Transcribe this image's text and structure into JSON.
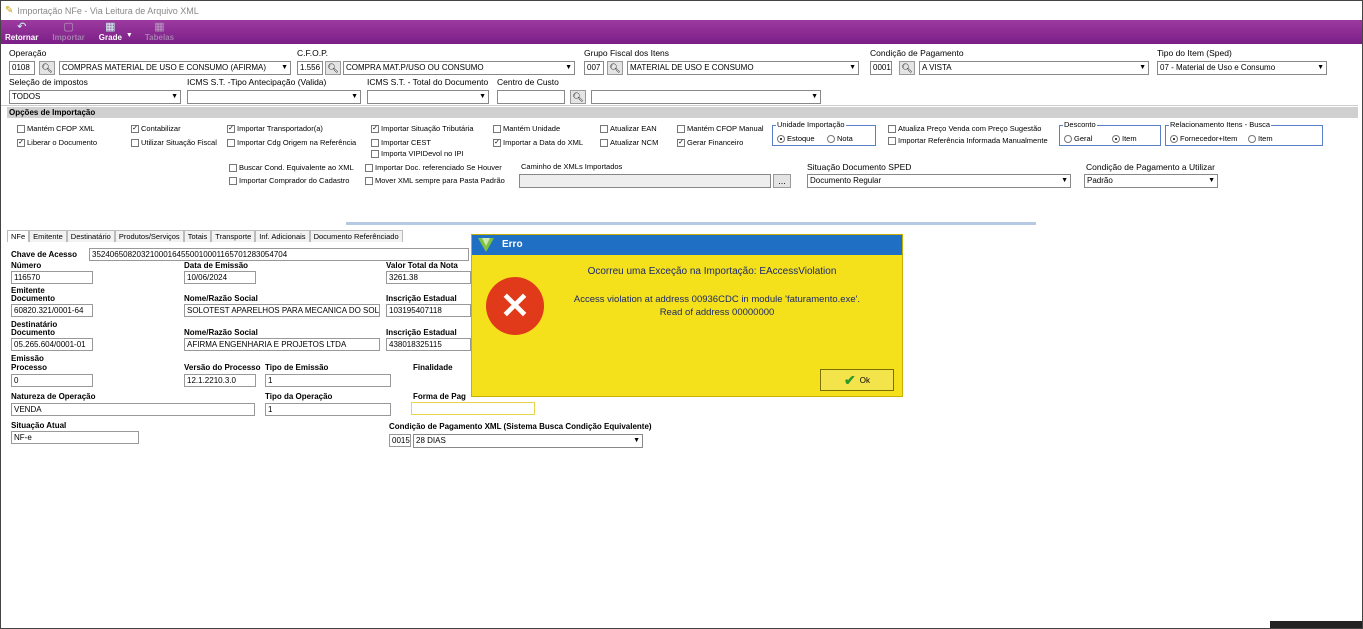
{
  "window": {
    "title": "Importação NFe - Via Leitura de Arquivo XML"
  },
  "toolbar": {
    "retornar": "Retornar",
    "importar": "Importar",
    "grade": "Grade",
    "tabelas": "Tabelas"
  },
  "filters": {
    "operacao": {
      "label": "Operação",
      "code": "0108",
      "value": "COMPRAS MATERIAL DE USO E CONSUMO (AFIRMA)"
    },
    "cfop": {
      "label": "C.F.O.P.",
      "code": "1.556",
      "value": "COMPRA MAT.P/USO OU CONSUMO"
    },
    "grupo": {
      "label": "Grupo Fiscal dos Itens",
      "code": "007",
      "value": "MATERIAL DE USO E CONSUMO"
    },
    "condicao": {
      "label": "Condição de Pagamento",
      "code": "0001",
      "value": "A VISTA"
    },
    "tipo_item": {
      "label": "Tipo do Item (Sped)",
      "value": "07 - Material de Uso e Consumo"
    },
    "selecao": {
      "label": "Seleção de impostos",
      "value": "TODOS"
    },
    "icms_antecip": {
      "label": "ICMS S.T. -Tipo Antecipação (Valida)",
      "value": ""
    },
    "icms_total": {
      "label": "ICMS S.T. - Total do Documento",
      "value": ""
    },
    "centro": {
      "label": "Centro de Custo",
      "code": "",
      "value": ""
    }
  },
  "options": {
    "title": "Opções de Importação",
    "mantem_cfop": "Mantém CFOP XML",
    "liberar_doc": "Liberar o Documento",
    "contabilizar": "Contabilizar",
    "utilizar_sit": "Utilizar Situação Fiscal",
    "imp_transp": "Importar Transportador(a)",
    "imp_cdg": "Importar Cdg Origem na Referência",
    "imp_sit_trib": "Importar Situação Tributária",
    "imp_cest": "Importar CEST",
    "imp_vipi": "Importa VIPIDevol no IPI",
    "mantem_unid": "Mantém Unidade",
    "imp_data": "Importar a Data do XML",
    "atual_ean": "Atualizar EAN",
    "atual_ncm": "Atualizar NCM",
    "mantem_cfop_man": "Mantém CFOP Manual",
    "gerar_fin": "Gerar Financeiro",
    "unidade": {
      "label": "Unidade Importação",
      "estoque": "Estoque",
      "nota": "Nota"
    },
    "atual_preco": "Atualiza Preço Venda com Preço Sugestão",
    "imp_ref": "Importar Referência Informada Manualmente",
    "desconto": {
      "label": "Desconto",
      "geral": "Geral",
      "item": "Item"
    },
    "relac": {
      "label": "Relacionamento Itens - Busca",
      "forn": "Fornecedor+Item",
      "item": "Item"
    },
    "buscar_cond": "Buscar Cond. Equivalente ao XML",
    "imp_comprador": "Importar Comprador do Cadastro",
    "imp_doc_ref": "Importar Doc. referenciado Se Houver",
    "mover_xml": "Mover XML sempre para Pasta Padrão",
    "caminho_label": "Caminho de XMLs Importados",
    "caminho_btn": "...",
    "sit_sped_label": "Situação Documento SPED",
    "sit_sped_value": "Documento Regular",
    "cond_util_label": "Condição de Pagamento a Utilizar",
    "cond_util_value": "Padrão"
  },
  "tabs": [
    "NFe",
    "Emitente",
    "Destinatário",
    "Produtos/Serviços",
    "Totais",
    "Transporte",
    "Inf. Adicionais",
    "Documento Referênciado"
  ],
  "nfe": {
    "chave_label": "Chave de Acesso",
    "chave": "35240650820321000164550010001165701283054704",
    "numero_label": "Número",
    "numero": "116570",
    "data_label": "Data de Emissão",
    "data": "10/06/2024",
    "valor_label": "Valor Total da Nota",
    "valor": "3261.38",
    "emitente_label": "Emitente",
    "documento_label": "Documento",
    "emit_doc": "60820.321/0001-64",
    "razao_label": "Nome/Razão Social",
    "emit_razao": "SOLOTEST APARELHOS PARA MECANICA DO SOLO",
    "ie_label": "Inscrição Estadual",
    "emit_ie": "103195407118",
    "destinatario_label": "Destinatário",
    "dest_doc": "05.265.604/0001-01",
    "dest_razao": "AFIRMA ENGENHARIA E PROJETOS LTDA",
    "dest_ie": "438018325115",
    "emissao_label": "Emissão",
    "processo_label": "Processo",
    "processo": "0",
    "versao_label": "Versão do Processo",
    "versao": "12.1.2210.3.0",
    "tipo_emissao_label": "Tipo de Emissão",
    "tipo_emissao": "1",
    "finalidade_label": "Finalidade",
    "natureza_label": "Natureza de Operação",
    "natureza": "VENDA",
    "tipo_op_label": "Tipo da Operação",
    "tipo_op": "1",
    "forma_label": "Forma de Pag",
    "situacao_label": "Situação Atual",
    "situacao": "NF-e",
    "cond_xml_label": "Condição de Pagamento XML (Sistema Busca Condição Equivalente)",
    "cond_xml_code": "0015",
    "cond_xml_value": "28 DIAS"
  },
  "dialog": {
    "title": "Erro",
    "message1": "Ocorreu uma Exceção na Importação: EAccessViolation",
    "message2": "Access violation at address 00936CDC in module 'faturamento.exe'.",
    "message3": "Read of address 00000000",
    "ok": "Ok"
  },
  "colors": {
    "toolbar": "#8a2a95",
    "dialog_bg": "#f5e01c",
    "dialog_title": "#1f6fc4",
    "error_icon": "#e03a1a"
  }
}
